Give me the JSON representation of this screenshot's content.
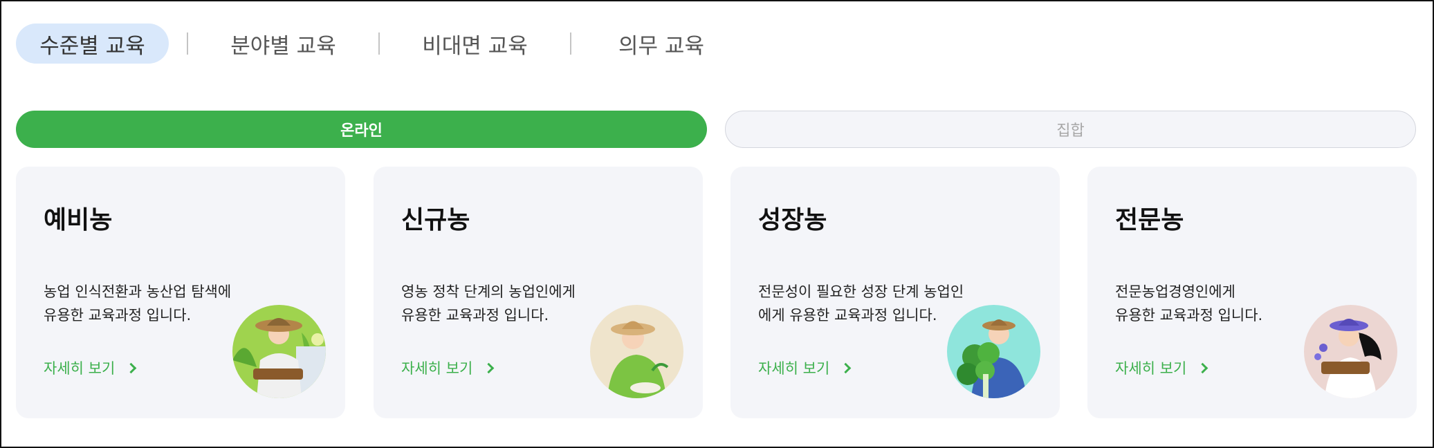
{
  "tabs": [
    {
      "label": "수준별 교육",
      "active": true
    },
    {
      "label": "분야별 교육",
      "active": false
    },
    {
      "label": "비대면 교육",
      "active": false
    },
    {
      "label": "의무 교육",
      "active": false
    }
  ],
  "modes": {
    "online": "온라인",
    "group": "집합",
    "selected": "online"
  },
  "cards": [
    {
      "title": "예비농",
      "description": "농업 인식전환과 농산업 탐색에\n유용한 교육과정 입니다.",
      "link": "자세히 보기",
      "illustration": "farmer-with-straw-hat-and-basket"
    },
    {
      "title": "신규농",
      "description": "영농 정착 단계의 농업인에게\n유용한 교육과정 입니다.",
      "link": "자세히 보기",
      "illustration": "farmer-tending-seedlings"
    },
    {
      "title": "성장농",
      "description": "전문성이 필요한 성장 단계 농업인\n에게 유용한 교육과정 입니다.",
      "link": "자세히 보기",
      "illustration": "farmer-holding-vegetables"
    },
    {
      "title": "전문농",
      "description": "전문농업경영인에게\n유용한 교육과정 입니다.",
      "link": "자세히 보기",
      "illustration": "farmer-with-flower-basket"
    }
  ],
  "colors": {
    "accent_green": "#3cb04c",
    "active_tab_bg": "#d9e8fb",
    "card_bg": "#f4f5f9"
  }
}
